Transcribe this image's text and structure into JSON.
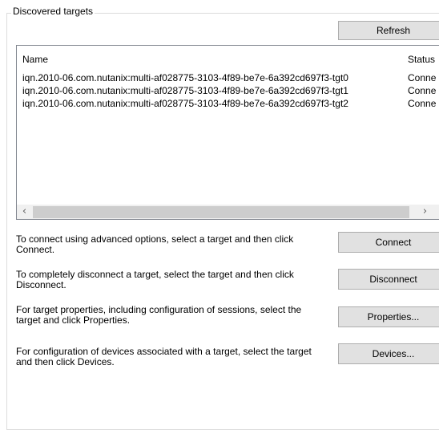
{
  "group": {
    "title": "Discovered targets"
  },
  "toolbar": {
    "refresh_label": "Refresh"
  },
  "targets_list": {
    "columns": [
      "Name",
      "Status"
    ],
    "rows": [
      [
        "iqn.2010-06.com.nutanix:multi-af028775-3103-4f89-be7e-6a392cd697f3-tgt0",
        "Conne"
      ],
      [
        "iqn.2010-06.com.nutanix:multi-af028775-3103-4f89-be7e-6a392cd697f3-tgt1",
        "Conne"
      ],
      [
        "iqn.2010-06.com.nutanix:multi-af028775-3103-4f89-be7e-6a392cd697f3-tgt2",
        "Conne"
      ]
    ]
  },
  "scrollbar": {
    "left_icon": "chevron-left-icon",
    "right_icon": "chevron-right-icon"
  },
  "actions": [
    {
      "text": "To connect using advanced options, select a target and then click Connect.",
      "button": "Connect"
    },
    {
      "text": "To completely disconnect a target, select the target and then click Disconnect.",
      "button": "Disconnect"
    },
    {
      "text": "For target properties, including configuration of sessions, select the target and click Properties.",
      "button": "Properties..."
    },
    {
      "text": "For configuration of devices associated with a target, select the target and then click Devices.",
      "button": "Devices..."
    }
  ]
}
